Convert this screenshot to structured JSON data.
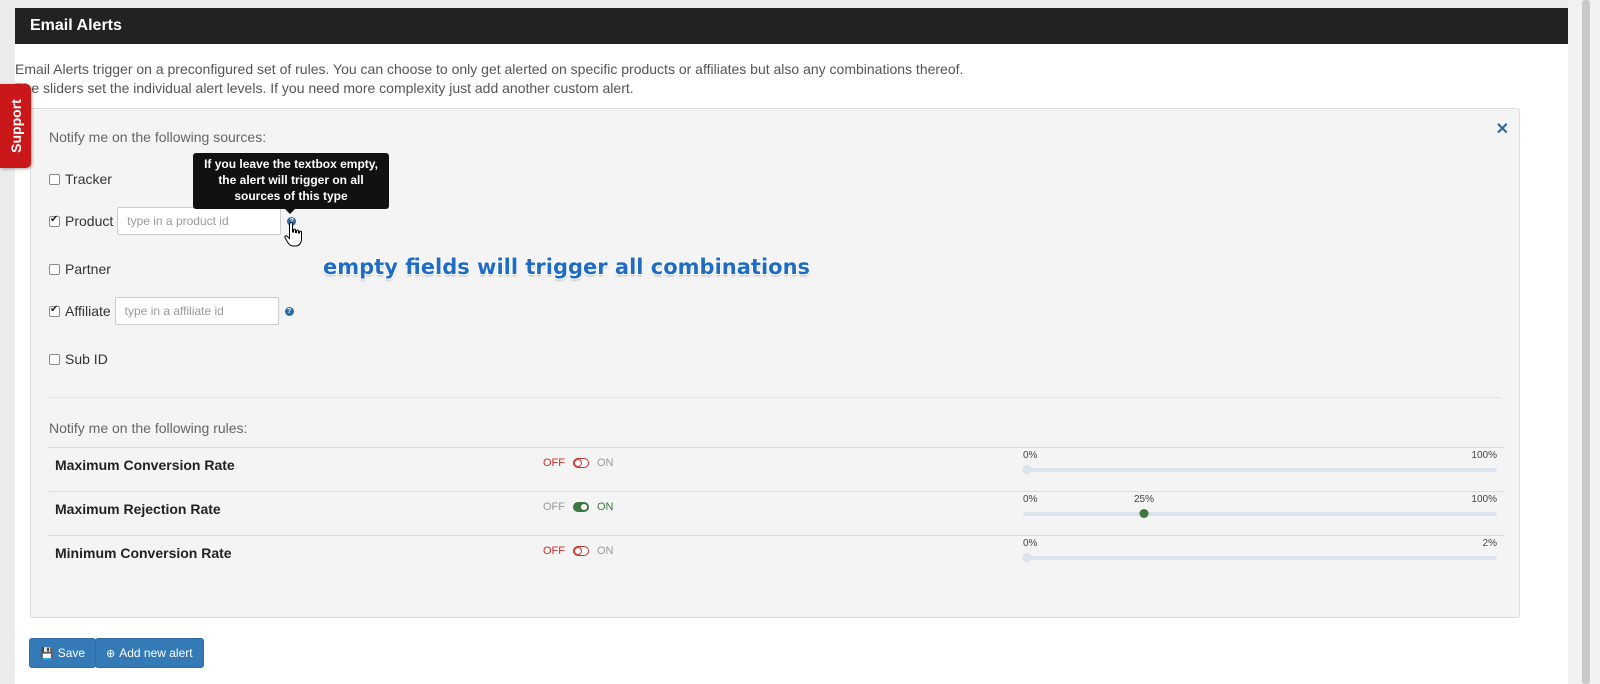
{
  "header": {
    "title": "Email Alerts"
  },
  "intro": {
    "line1": "Email Alerts trigger on a preconfigured set of rules. You can choose to only get alerted on specific products or affiliates but also any combinations thereof.",
    "line2": "The sliders set the individual alert levels. If you need more complexity just add another custom alert."
  },
  "support_tab": {
    "label": "Support"
  },
  "sources": {
    "heading": "Notify me on the following sources:",
    "items": [
      {
        "label": "Tracker",
        "checked": false
      },
      {
        "label": "Product",
        "checked": true,
        "placeholder": "type in a product id"
      },
      {
        "label": "Partner",
        "checked": false
      },
      {
        "label": "Affiliate",
        "checked": true,
        "placeholder": "type in a affiliate id"
      },
      {
        "label": "Sub ID",
        "checked": false
      }
    ],
    "tooltip": "If you leave the textbox empty, the alert will trigger on all sources of this type",
    "help_icon_glyph": "?"
  },
  "annotation": "empty fields will trigger all combinations",
  "rules": {
    "heading": "Notify me on the following rules:",
    "off_label": "OFF",
    "on_label": "ON",
    "items": [
      {
        "name": "Maximum Conversion Rate",
        "enabled": false,
        "min_label": "0%",
        "max_label": "100%",
        "value": null,
        "value_label": ""
      },
      {
        "name": "Maximum Rejection Rate",
        "enabled": true,
        "min_label": "0%",
        "max_label": "100%",
        "value": 0.25,
        "value_label": "25%"
      },
      {
        "name": "Minimum Conversion Rate",
        "enabled": false,
        "min_label": "0%",
        "max_label": "2%",
        "value": null,
        "value_label": ""
      }
    ]
  },
  "buttons": {
    "save": "Save",
    "add_new": "Add new alert"
  },
  "colors": {
    "header_bg": "#222222",
    "support_red": "#c9171a",
    "accent_blue": "#337ab7",
    "on_green": "#3c763d",
    "off_red": "#c9302c",
    "annotation_blue": "#1e6cc4"
  }
}
